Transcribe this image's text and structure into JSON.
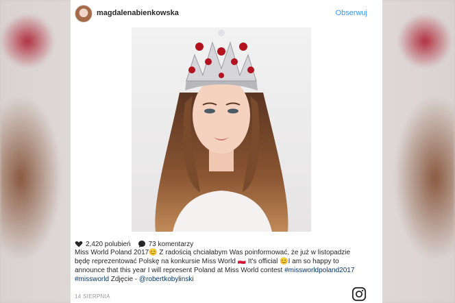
{
  "post": {
    "username": "magdalenabienkowska",
    "follow_label": "Obserwuj",
    "likes_text": "2,420 polubień",
    "comments_text": "73 komentarzy",
    "caption": {
      "part1": "Miss World Poland 2017😊 Z radością chciałabym Was poinformować, że już w listopadzie będę reprezentować Polskę na konkursie Miss World 🇵🇱 It's official 😊I am so happy to announce that this year I will represent Poland at Miss World contest ",
      "tag1": "#missworldpoland2017",
      "tag2": "#missworld",
      "part2": " Zdjęcie - ",
      "mention": "@robertkobylinski"
    },
    "date": "14 SIERPNIA"
  },
  "icons": {
    "like": "heart-icon",
    "comment": "comment-bubble-icon",
    "brand": "instagram-icon"
  },
  "colors": {
    "link": "#3897f0",
    "text": "#262626",
    "crown_jewel": "#b3121f"
  }
}
